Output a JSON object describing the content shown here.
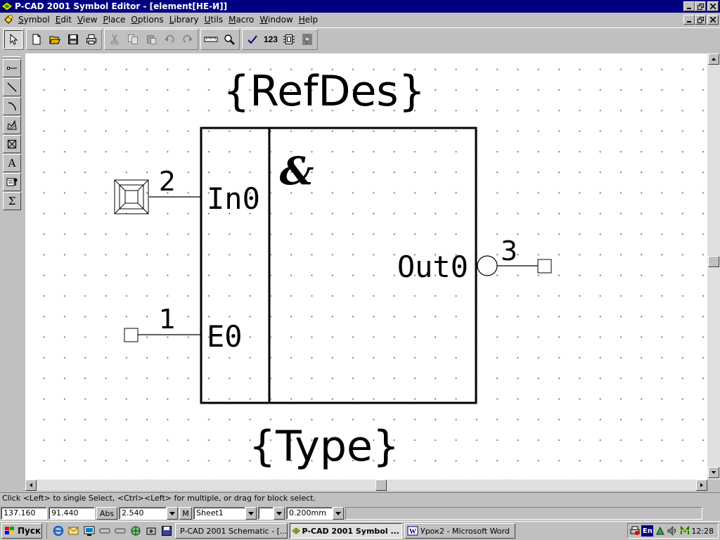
{
  "window": {
    "title": "P-CAD 2001 Symbol Editor - [element[НЕ-И]]"
  },
  "menu": {
    "items": [
      "Symbol",
      "Edit",
      "View",
      "Place",
      "Options",
      "Library",
      "Utils",
      "Macro",
      "Window",
      "Help"
    ]
  },
  "toolbar": {
    "icons": [
      "select-arrow-icon",
      "new-file-icon",
      "open-folder-icon",
      "save-disk-icon",
      "print-icon",
      "cut-icon",
      "copy-icon",
      "paste-icon",
      "undo-icon",
      "redo-icon",
      "measure-ruler-icon",
      "zoom-icon",
      "validate-check-icon",
      "renumber-icon",
      "symbol-wizard-icon",
      "lightning-icon"
    ],
    "renumber_label": "123"
  },
  "palette": {
    "icons": [
      "place-pin-icon",
      "place-line-icon",
      "place-arc-icon",
      "place-polygon-icon",
      "place-field-icon",
      "place-text-icon",
      "place-attribute-icon",
      "place-ieee-symbol-icon"
    ],
    "text_tool_label": "A",
    "sum_tool_label": "Σ"
  },
  "symbol": {
    "refdes": "{RefDes}",
    "type": "{Type}",
    "function_label": "&",
    "pins": [
      {
        "number": "2",
        "name": "In0"
      },
      {
        "number": "1",
        "name": "E0"
      },
      {
        "number": "3",
        "name": "Out0"
      }
    ]
  },
  "status": {
    "prompt": "Click <Left> to single Select, <Ctrl><Left> for multiple, or drag for block select.",
    "x_coord": "137.160",
    "y_coord": "91.440",
    "abs_label": "Abs",
    "grid": "2.540",
    "m_label": "M",
    "sheet": "Sheet1",
    "line_width": "0.200mm"
  },
  "taskbar": {
    "start_label": "Пуск",
    "tasks": [
      {
        "label": "P-CAD 2001 Schematic - [..."
      },
      {
        "label": "P-CAD 2001 Symbol ..."
      },
      {
        "label": "Урок2 - Microsoft Word"
      }
    ],
    "tray_lang": "En",
    "clock": "12:28"
  },
  "colors": {
    "titlebar": "#000080",
    "face": "#c0c0c0",
    "canvas": "#ffffff",
    "ink": "#000000"
  }
}
